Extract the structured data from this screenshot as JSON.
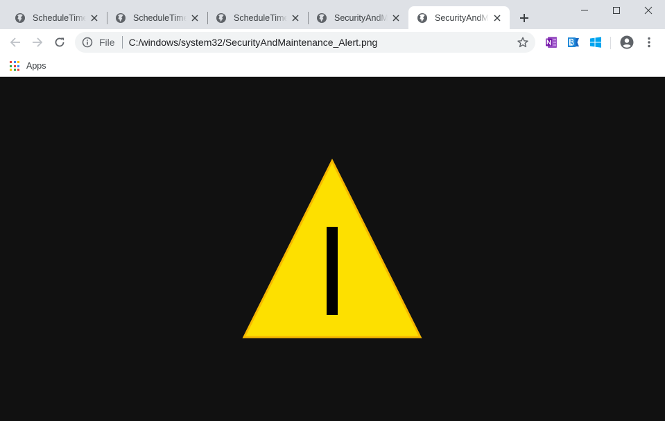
{
  "tabs": [
    {
      "title": "ScheduleTime_...",
      "active": false
    },
    {
      "title": "ScheduleTime_...",
      "active": false
    },
    {
      "title": "ScheduleTime_...",
      "active": false
    },
    {
      "title": "SecurityAndMaintenance_Alert.png",
      "active": false
    },
    {
      "title": "SecurityAndMaintenance_Alert.png",
      "active": true
    }
  ],
  "tab_labels": {
    "t0": "ScheduleTime_",
    "t1": "ScheduleTime_",
    "t2": "ScheduleTime_",
    "t3": "SecurityAndMa",
    "t4": "SecurityAndMa"
  },
  "omnibox": {
    "scheme_label": "File",
    "url": "C:/windows/system32/SecurityAndMaintenance_Alert.png"
  },
  "bookmarks": {
    "apps_label": "Apps"
  },
  "extensions": [
    "onenote-icon",
    "bing-icon",
    "windows-icon"
  ],
  "colors": {
    "tabstrip_bg": "#dee1e6",
    "content_bg": "#111111",
    "warning_fill": "#fde000",
    "warning_stroke": "#f6b800"
  }
}
